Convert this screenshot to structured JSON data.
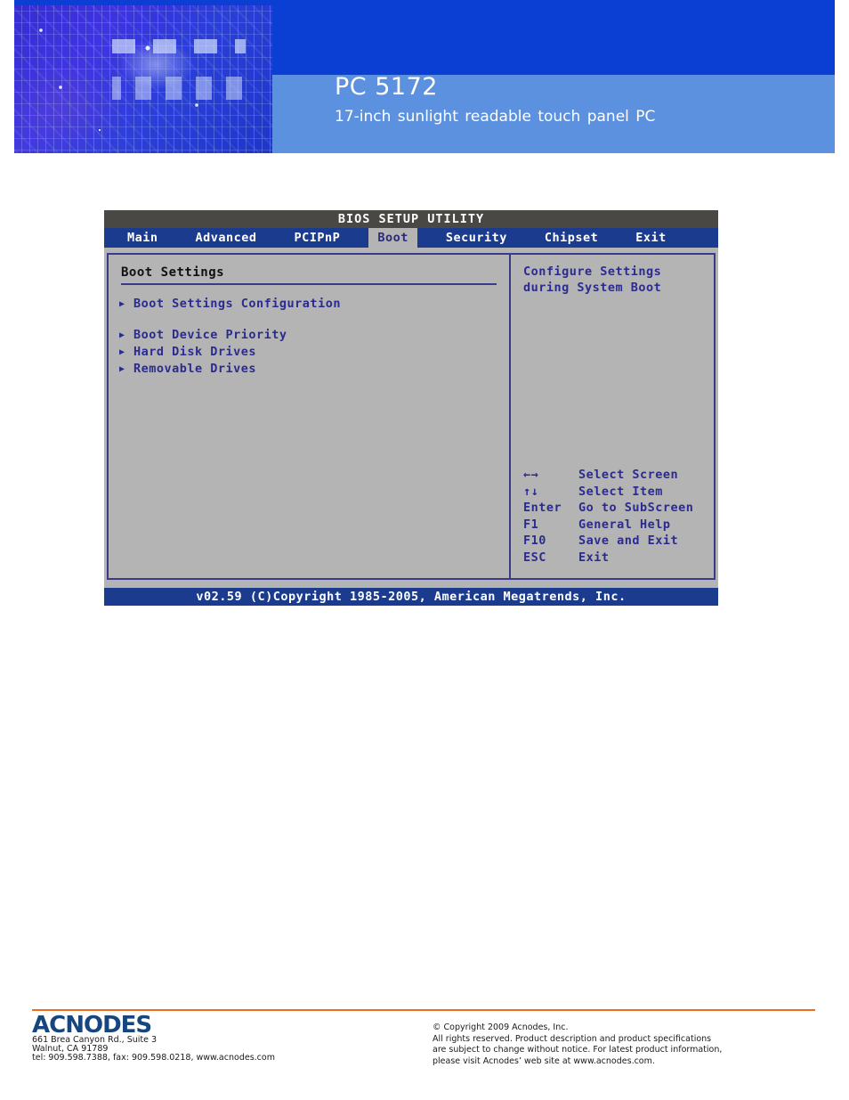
{
  "header": {
    "title": "PC 5172",
    "subtitle": "17-inch sunlight readable touch panel PC",
    "photo_alt": "circuit-board-photo",
    "band_top_color": "#0b3fd4",
    "band_bottom_color": "#5b91de"
  },
  "bios": {
    "titlebar": "BIOS SETUP UTILITY",
    "tabs": [
      {
        "label": "Main",
        "selected": false
      },
      {
        "label": "Advanced",
        "selected": false
      },
      {
        "label": "PCIPnP",
        "selected": false
      },
      {
        "label": "Boot",
        "selected": true
      },
      {
        "label": "Security",
        "selected": false
      },
      {
        "label": "Chipset",
        "selected": false
      },
      {
        "label": "Exit",
        "selected": false
      }
    ],
    "left_panel": {
      "heading": "Boot Settings",
      "items": [
        {
          "label": "Boot Settings Configuration",
          "bullet": "▶",
          "gap_after": true
        },
        {
          "label": "Boot Device Priority",
          "bullet": "▶",
          "gap_after": false
        },
        {
          "label": "Hard Disk Drives",
          "bullet": "▶",
          "gap_after": false
        },
        {
          "label": "Removable Drives",
          "bullet": "▶",
          "gap_after": false
        }
      ]
    },
    "right_panel": {
      "help_line1": "Configure Settings",
      "help_line2": "during System Boot",
      "keys": [
        {
          "key": "←→",
          "desc": "Select Screen"
        },
        {
          "key": "↑↓",
          "desc": "Select Item"
        },
        {
          "key": "Enter",
          "desc": "Go to SubScreen"
        },
        {
          "key": "F1",
          "desc": "General Help"
        },
        {
          "key": "F10",
          "desc": "Save and Exit"
        },
        {
          "key": "ESC",
          "desc": "Exit"
        }
      ]
    },
    "footer": "v02.59 (C)Copyright 1985-2005, American Megatrends, Inc.",
    "tab_bar_color": "#1b3c8e",
    "panel_bg_color": "#b4b4b4",
    "panel_border_color": "#3a3a8c",
    "titlebar_color": "#4a4845"
  },
  "page_footer": {
    "rule_color": "#f06c20",
    "logo_text": "ACNODES",
    "address_lines": [
      "661 Brea Canyon Rd., Suite 3",
      "Walnut, CA 91789",
      "tel: 909.598.7388, fax: 909.598.0218, www.acnodes.com"
    ],
    "copyright_lines": [
      "© Copyright 2009 Acnodes, Inc.",
      "All rights reserved. Product description and product specifications",
      "are subject to change without notice. For latest product information,",
      "please visit Acnodes’ web site at www.acnodes.com."
    ]
  }
}
